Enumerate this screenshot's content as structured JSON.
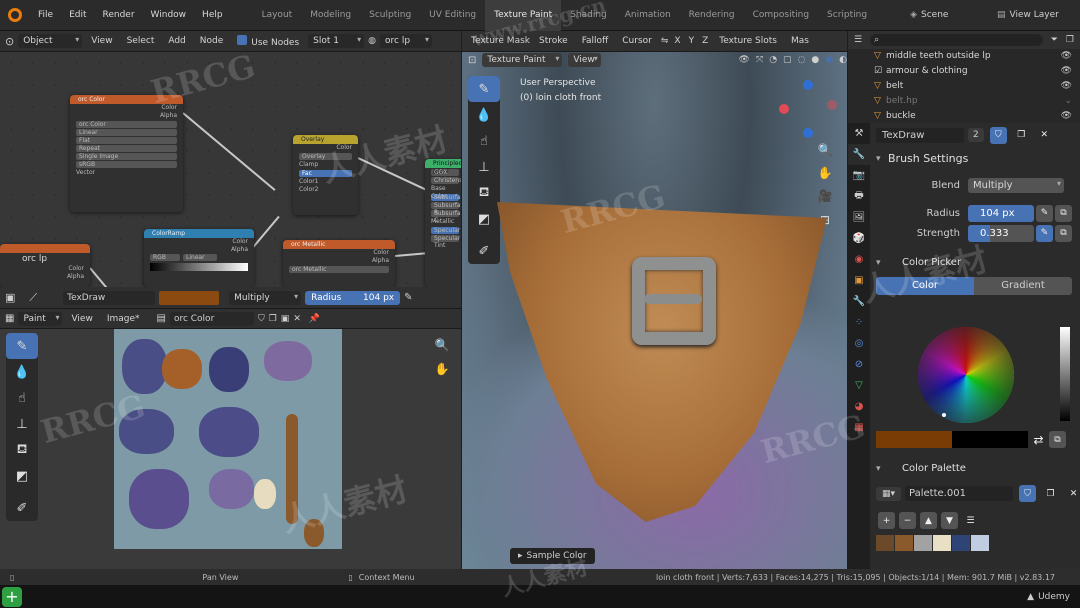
{
  "topbar": {
    "menus": [
      "File",
      "Edit",
      "Render",
      "Window",
      "Help"
    ],
    "workspaces": [
      "Layout",
      "Modeling",
      "Sculpting",
      "UV Editing",
      "Texture Paint",
      "Shading",
      "Animation",
      "Rendering",
      "Compositing",
      "Scripting"
    ],
    "active_workspace": "Texture Paint",
    "scene": "Scene",
    "view_layer": "View Layer"
  },
  "node_header": {
    "object_mode": "Object",
    "items": [
      "View",
      "Select",
      "Add",
      "Node"
    ],
    "use_nodes": "Use Nodes",
    "slot": "Slot 1",
    "material": "orc lp"
  },
  "nodes": {
    "color_node": {
      "title": "orc Color",
      "out1": "Color",
      "out2": "Alpha",
      "image": "orc Color",
      "opts": [
        "Linear",
        "Flat",
        "Repeat",
        "Single Image"
      ],
      "colorspace": "sRGB",
      "vector": "Vector"
    },
    "overlay": {
      "title": "Overlay",
      "out": "Color",
      "mode": "Overlay",
      "clamp": "Clamp",
      "fac": "Fac",
      "c1": "Color1",
      "c2": "Color2"
    },
    "metallic": {
      "title": "orc Metallic",
      "out1": "Color",
      "out2": "Alpha",
      "image": "orc Metallic"
    },
    "bsdf": {
      "title": "Principled BSDF",
      "rows": [
        "GGX",
        "Christensen",
        "Base Color",
        "Subsurface",
        "Subsurface R",
        "Subsurface C",
        "Metallic",
        "Specular",
        "Specular Tint"
      ]
    },
    "colorramp": {
      "title": "ColorRamp",
      "out1": "Color",
      "out2": "Alpha",
      "mode": "RGB",
      "interp": "Linear"
    },
    "orc_lp": {
      "title": "orc lp",
      "out1": "Color",
      "out2": "Alpha"
    }
  },
  "brush_header": {
    "brush": "TexDraw",
    "color": "#8a4a10",
    "blend": "Multiply",
    "radius_label": "Radius",
    "radius": "104 px"
  },
  "image_header": {
    "mode": "Paint",
    "items": [
      "View",
      "Image*"
    ],
    "image": "orc Color"
  },
  "viewport": {
    "header_mode": "Texture Paint",
    "header_items": [
      "View"
    ],
    "sub_items": [
      "Texture Mask",
      "Stroke",
      "Falloff",
      "Cursor"
    ],
    "axes": [
      "X",
      "Y",
      "Z"
    ],
    "texture_slots": "Texture Slots",
    "mask": "Mas",
    "perspective": "User Perspective",
    "object_name": "(0) loin cloth front",
    "sample_color": "Sample Color"
  },
  "outliner": {
    "items": [
      {
        "label": "middle teeth outside lp"
      },
      {
        "label": "armour & clothing"
      },
      {
        "label": "belt"
      },
      {
        "label": "belt.hp"
      },
      {
        "label": "buckle"
      }
    ]
  },
  "properties": {
    "brush_name": "TexDraw",
    "brush_users": "2",
    "brush_settings": "Brush Settings",
    "blend_label": "Blend",
    "blend": "Multiply",
    "radius_label": "Radius",
    "radius": "104 px",
    "strength_label": "Strength",
    "strength": "0.333",
    "strength_value": 0.333,
    "color_picker": "Color Picker",
    "tab_color": "Color",
    "tab_gradient": "Gradient",
    "primary_color": "#7a3c05",
    "secondary_color": "#000000",
    "color_palette": "Color Palette",
    "palette_name": "Palette.001",
    "palette_colors": [
      "#6b4a2a",
      "#8a5a2c",
      "#a2a2a2",
      "#e9dfc4",
      "#2f4476",
      "#c0cde0"
    ]
  },
  "status": {
    "left1": "Pan View",
    "left2": "Context Menu",
    "right": "loin cloth front | Verts:7,633 | Faces:14,275 | Tris:15,095 | Objects:1/14 | Mem: 901.7 MiB | v2.83.17"
  },
  "video_bar": {
    "brand": "Udemy"
  },
  "watermarks": [
    "RRCG",
    "人人素材",
    "www.rrcg.cn"
  ]
}
